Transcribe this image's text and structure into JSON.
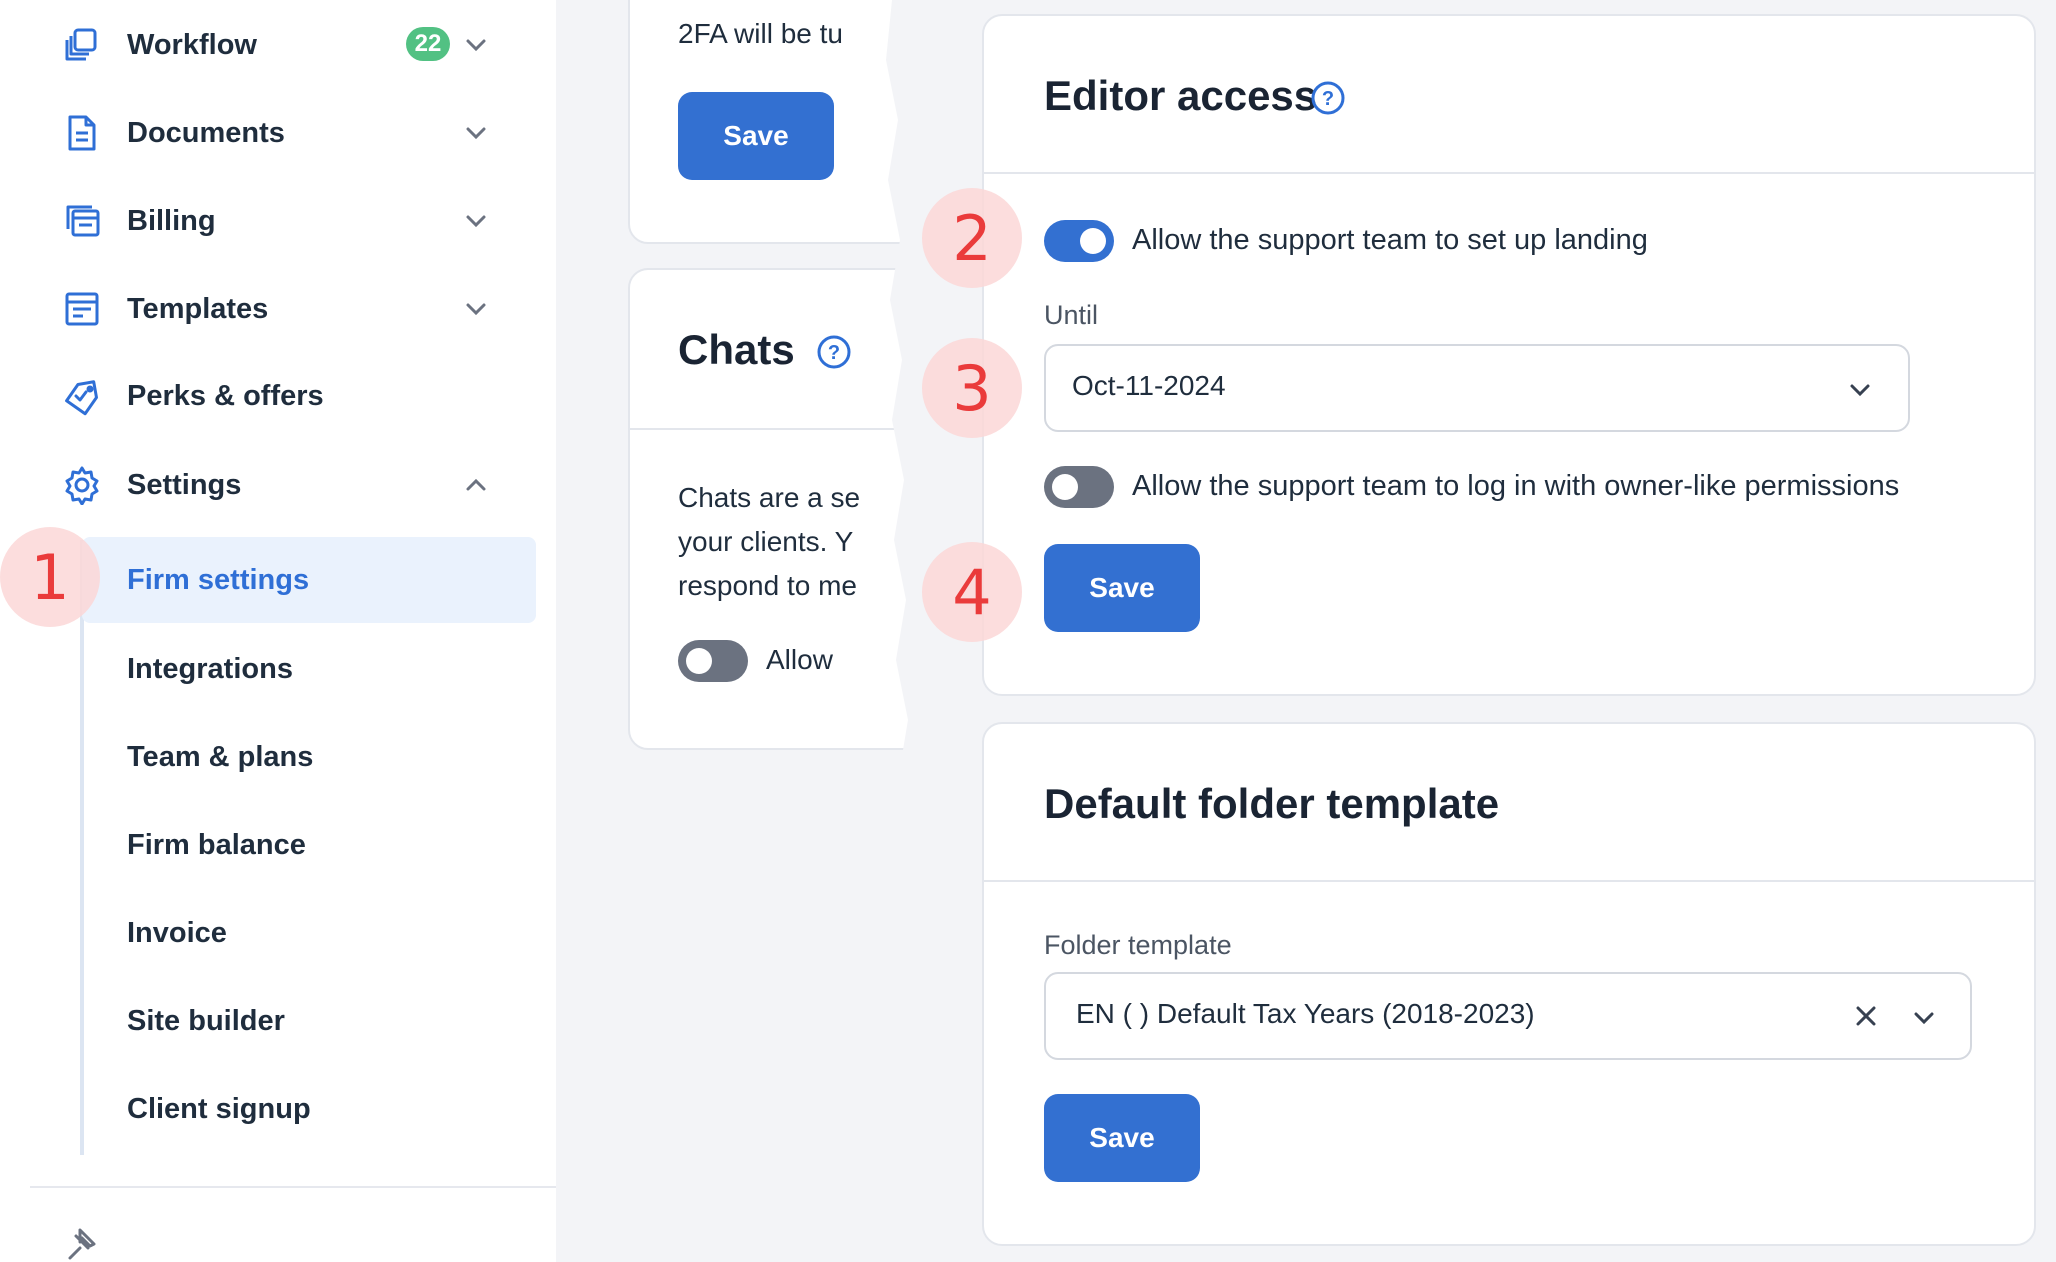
{
  "sidebar": {
    "items": [
      {
        "label": "Workflow",
        "icon": "workflow-icon",
        "badge": "22"
      },
      {
        "label": "Documents",
        "icon": "documents-icon"
      },
      {
        "label": "Billing",
        "icon": "billing-icon"
      },
      {
        "label": "Templates",
        "icon": "templates-icon"
      },
      {
        "label": "Perks & offers",
        "icon": "perks-icon"
      },
      {
        "label": "Settings",
        "icon": "gear-icon"
      }
    ],
    "subitems": [
      {
        "label": "Firm settings"
      },
      {
        "label": "Integrations"
      },
      {
        "label": "Team & plans"
      },
      {
        "label": "Firm balance"
      },
      {
        "label": "Invoice"
      },
      {
        "label": "Site builder"
      },
      {
        "label": "Client signup"
      }
    ]
  },
  "middle": {
    "twofa_text": "2FA will be tu",
    "save_label": "Save",
    "chats_title": "Chats",
    "chats_lines": [
      "Chats are a se",
      "your clients. Y",
      "respond to me"
    ],
    "chats_toggle_label": "Allow"
  },
  "editor_access": {
    "title": "Editor access",
    "toggle1_label": "Allow the support team to set up landing",
    "until_label": "Until",
    "until_value": "Oct-11-2024",
    "toggle2_label": "Allow the support team to log in with owner-like permissions",
    "save_label": "Save"
  },
  "folder_template": {
    "title": "Default folder template",
    "field_label": "Folder template",
    "value": "EN ( ) Default Tax Years (2018-2023)",
    "save_label": "Save"
  },
  "callouts": [
    "1",
    "2",
    "3",
    "4"
  ],
  "colors": {
    "accent": "#3370d1",
    "badge": "#52c183",
    "callout": "#ea3b3b",
    "icon": "#2f6fd6"
  }
}
